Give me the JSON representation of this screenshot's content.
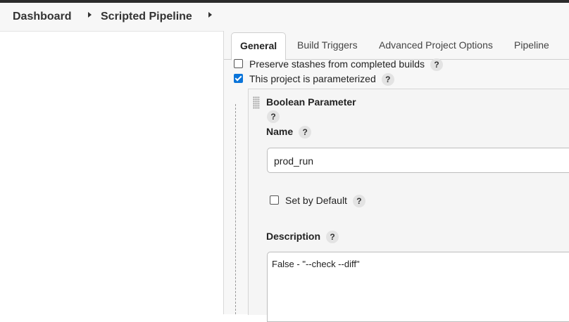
{
  "breadcrumb": {
    "items": [
      "Dashboard",
      "Scripted Pipeline"
    ]
  },
  "tabs": [
    "General",
    "Build Triggers",
    "Advanced Project Options",
    "Pipeline"
  ],
  "options": {
    "preserve_stashes": {
      "label": "Preserve stashes from completed builds",
      "checked": false
    },
    "parameterized": {
      "label": "This project is parameterized",
      "checked": true
    }
  },
  "help_glyph": "?",
  "parameter": {
    "title": "Boolean Parameter",
    "name_label": "Name",
    "name_value": "prod_run",
    "default_label": "Set by Default",
    "default_checked": false,
    "description_label": "Description",
    "description_value": "False - \"--check --diff\""
  },
  "colors": {
    "accent": "#0a74d9",
    "topbar": "#2b2b2b"
  }
}
